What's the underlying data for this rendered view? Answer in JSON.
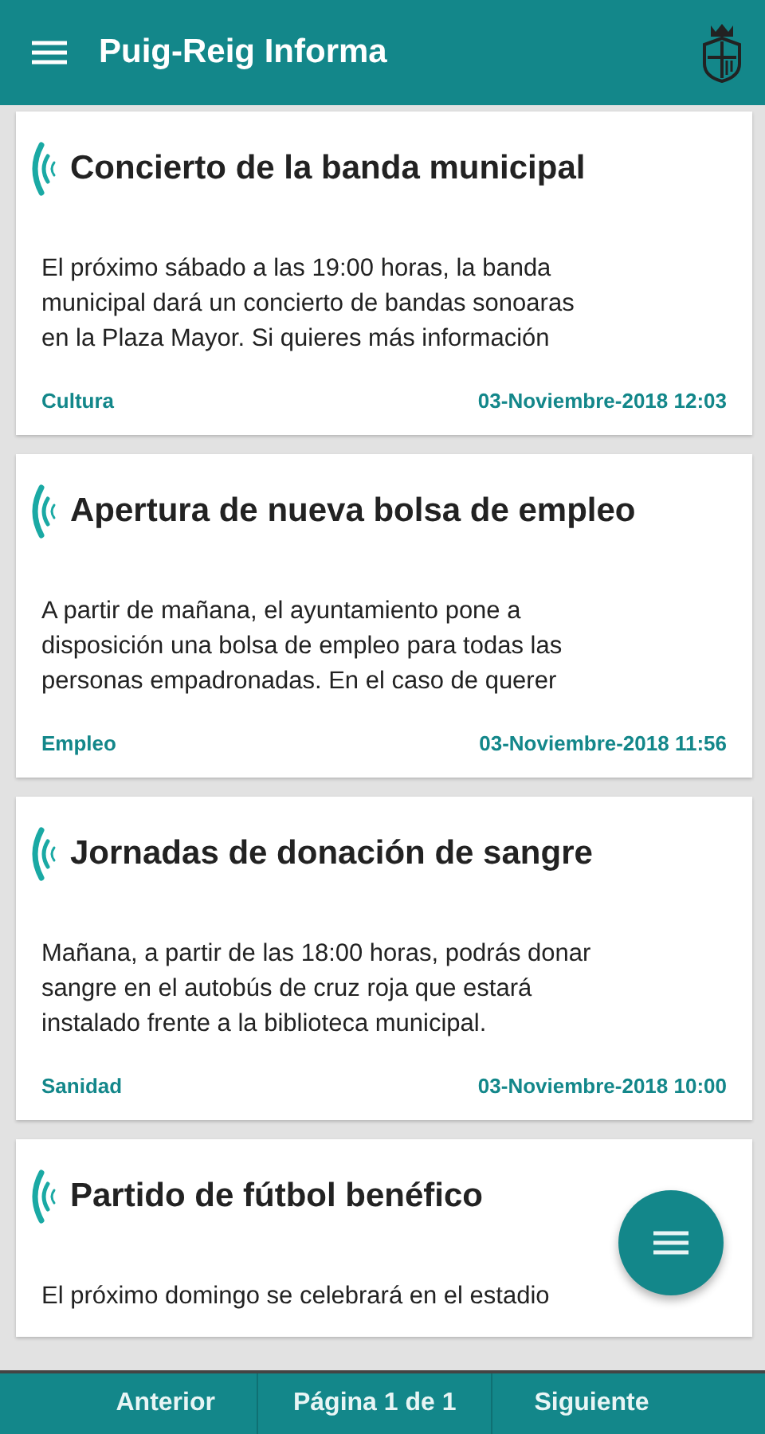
{
  "app_bar": {
    "title": "Puig-Reig Informa"
  },
  "news": [
    {
      "title": "Concierto de la banda municipal",
      "body_lines": [
        "El próximo sábado a las 19:00 horas, la banda",
        "municipal dará un concierto de bandas sonoaras",
        "en la Plaza Mayor. Si quieres más información"
      ],
      "category": "Cultura",
      "date": "03-Noviembre-2018 12:03"
    },
    {
      "title": "Apertura de nueva bolsa de empleo",
      "body_lines": [
        "A partir de mañana, el ayuntamiento pone a",
        "disposición una bolsa de empleo para todas las",
        "personas empadronadas. En el caso de querer"
      ],
      "category": "Empleo",
      "date": "03-Noviembre-2018 11:56"
    },
    {
      "title": "Jornadas de donación de sangre",
      "body_lines": [
        "Mañana, a partir de las 18:00 horas, podrás donar",
        "sangre en el autobús de cruz roja que estará",
        "instalado frente a la biblioteca municipal."
      ],
      "category": "Sanidad",
      "date": "03-Noviembre-2018 10:00"
    },
    {
      "title": "Partido de fútbol benéfico",
      "body_lines": [
        "El próximo domingo se celebrará en el estadio"
      ]
    }
  ],
  "pager": {
    "previous": "Anterior",
    "page": "Página 1 de 1",
    "next": "Siguiente"
  }
}
